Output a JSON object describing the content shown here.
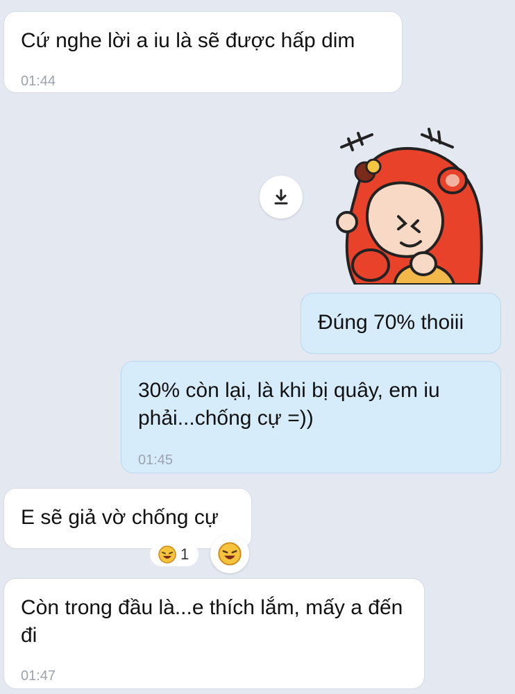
{
  "messages": [
    {
      "text": "Cứ nghe lời a iu là sẽ được hấp dim",
      "time": "01:44"
    },
    {
      "text": "Đúng 70% thoiii"
    },
    {
      "text": "30% còn lại, là khi bị quây, em iu phải...chống cự =))",
      "time": "01:45"
    },
    {
      "text": "E sẽ giả vờ chống cự"
    },
    {
      "text": "Còn trong đầu là...e thích lắm, mấy a đến đi",
      "time": "01:47"
    }
  ],
  "reaction": {
    "count": "1",
    "icon": "laughing-emoji-icon"
  },
  "sticker": {
    "icon": "monkey-costume-sticker"
  },
  "download": {
    "icon": "download-icon"
  },
  "colors": {
    "background": "#e4e8f0",
    "incoming": "#ffffff",
    "outgoing": "#d7ecfb",
    "sticker_red": "#e8432a"
  }
}
